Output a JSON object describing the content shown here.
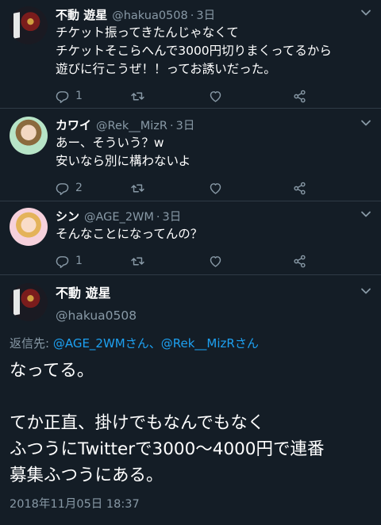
{
  "colors": {
    "background": "#141d26",
    "text": "#ffffff",
    "muted": "#8899a6",
    "link": "#1da1f2",
    "divider": "#2f3b46"
  },
  "tweets": [
    {
      "name": "不動 遊星",
      "handle": "@hakua0508",
      "separator": "·",
      "time": "3日",
      "lines": [
        "チケット振ってきたんじゃなくて",
        "チケットそこらへんで3000円切りまくってるから",
        "遊びに行こうぜ！！ってお誘いだった。"
      ],
      "reply_count": "1",
      "retweet_count": "",
      "like_count": "",
      "icons": [
        "reply-icon",
        "retweet-icon",
        "like-icon",
        "share-icon",
        "chevron-down-icon"
      ]
    },
    {
      "name": "カワイ",
      "handle": "@Rek__MizR",
      "separator": "·",
      "time": "3日",
      "lines": [
        "あー、そういう？w",
        "安いなら別に構わないよ"
      ],
      "reply_count": "2",
      "retweet_count": "",
      "like_count": ""
    },
    {
      "name": "シン",
      "handle": "@AGE_2WM",
      "separator": "·",
      "time": "3日",
      "lines": [
        "そんなことになってんの？"
      ],
      "reply_count": "1",
      "retweet_count": "",
      "like_count": ""
    }
  ],
  "detail": {
    "name": "不動 遊星",
    "handle": "@hakua0508",
    "reply_label": "返信先: ",
    "mentions": "@AGE_2WMさん、@Rek__MizRさん",
    "lines": [
      "なってる。",
      "",
      "てか正直、掛けでもなんでもなく",
      "ふつうにTwitterで3000〜4000円で連番",
      "募集ふつうにある。"
    ],
    "timestamp": "2018年11月05日 18:37"
  }
}
